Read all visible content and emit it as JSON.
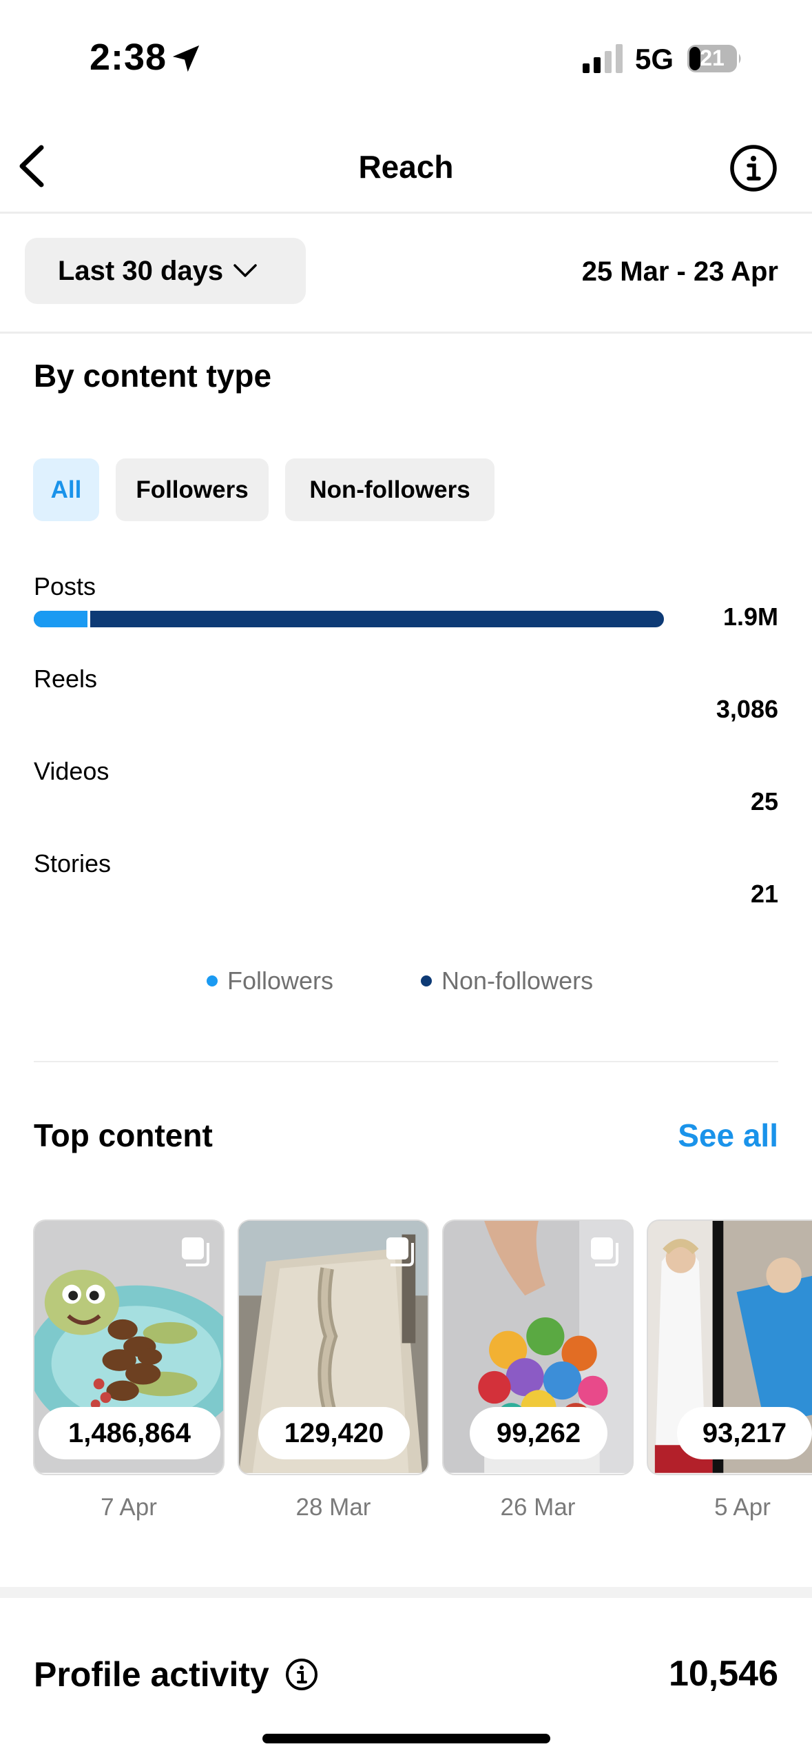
{
  "status_bar": {
    "time": "2:38",
    "network": "5G",
    "battery": "21"
  },
  "nav": {
    "title": "Reach"
  },
  "range": {
    "selector_label": "Last 30 days",
    "dates": "25 Mar - 23 Apr"
  },
  "content_type": {
    "title": "By content type",
    "tabs": [
      {
        "label": "All",
        "active": true
      },
      {
        "label": "Followers",
        "active": false
      },
      {
        "label": "Non-followers",
        "active": false
      }
    ],
    "rows": [
      {
        "label": "Posts",
        "value": "1.9M",
        "followers_fraction": 0.09,
        "bar_fraction": 1.0
      },
      {
        "label": "Reels",
        "value": "3,086"
      },
      {
        "label": "Videos",
        "value": "25"
      },
      {
        "label": "Stories",
        "value": "21"
      }
    ],
    "legend": [
      {
        "label": "Followers",
        "color": "#1a9af2"
      },
      {
        "label": "Non-followers",
        "color": "#0d3a75"
      }
    ]
  },
  "top_content": {
    "title": "Top content",
    "see_all": "See all",
    "items": [
      {
        "value": "1,486,864",
        "date": "7 Apr"
      },
      {
        "value": "129,420",
        "date": "28 Mar"
      },
      {
        "value": "99,262",
        "date": "26 Mar"
      },
      {
        "value": "93,217",
        "date": "5 Apr"
      }
    ]
  },
  "profile_activity": {
    "title": "Profile activity",
    "value": "10,546"
  },
  "colors": {
    "accent": "#1a93ea",
    "followers": "#1a9af2",
    "non_followers": "#0d3a75"
  }
}
